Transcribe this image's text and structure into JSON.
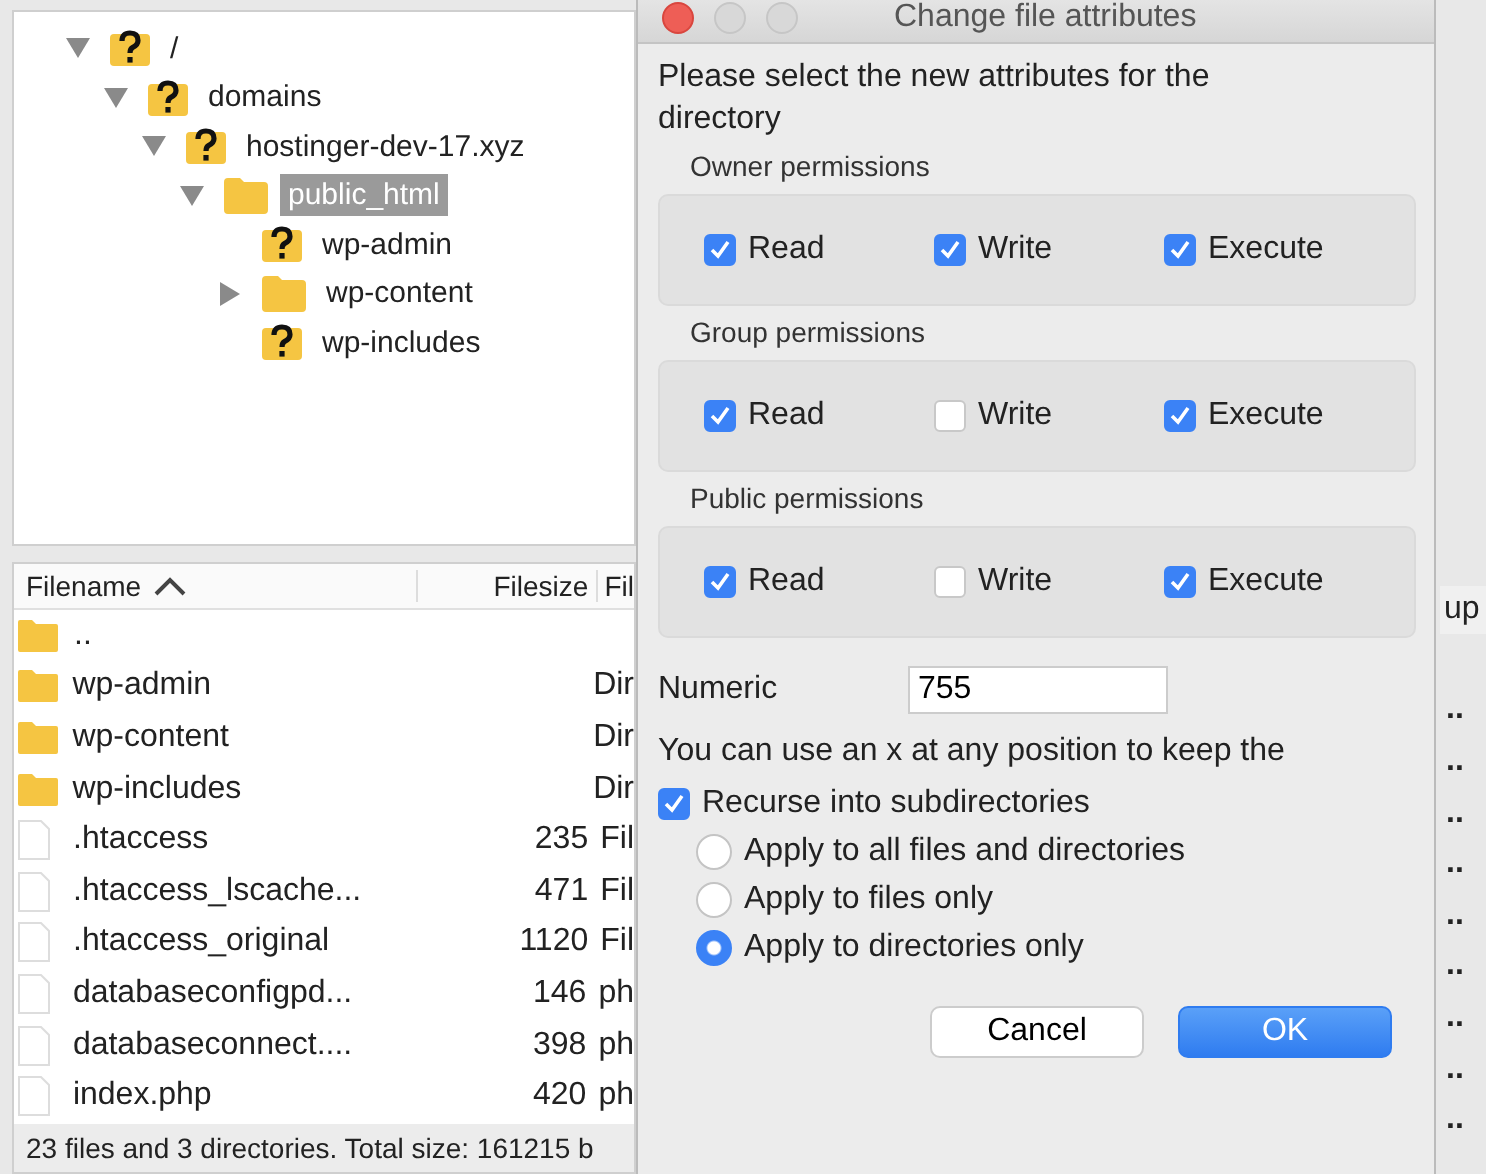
{
  "tree": [
    {
      "label": "/",
      "kind": "unknown",
      "expanded": true,
      "selected": false,
      "children": [
        {
          "label": "domains",
          "kind": "unknown",
          "expanded": true,
          "selected": false,
          "children": [
            {
              "label": "hostinger-dev-17.xyz",
              "kind": "unknown",
              "expanded": true,
              "selected": false,
              "children": [
                {
                  "label": "public_html",
                  "kind": "folder",
                  "expanded": true,
                  "selected": true,
                  "children": [
                    {
                      "label": "wp-admin",
                      "kind": "unknown",
                      "selected": false
                    },
                    {
                      "label": "wp-content",
                      "kind": "folder",
                      "expanded": false,
                      "selected": false
                    },
                    {
                      "label": "wp-includes",
                      "kind": "unknown",
                      "selected": false
                    }
                  ]
                }
              ]
            }
          ]
        }
      ]
    }
  ],
  "file_list": {
    "columns": [
      "Filename",
      "Filesize",
      "Fil"
    ],
    "right_header": "up",
    "rows": [
      {
        "kind": "folder",
        "name": "..",
        "size": "",
        "type": "",
        "column_4": ""
      },
      {
        "kind": "folder",
        "name": "wp-admin",
        "size": "",
        "type": "Dir",
        "column_4": ".."
      },
      {
        "kind": "folder",
        "name": "wp-content",
        "size": "",
        "type": "Dir",
        "column_4": ".."
      },
      {
        "kind": "folder",
        "name": "wp-includes",
        "size": "",
        "type": "Dir",
        "column_4": ".."
      },
      {
        "kind": "file",
        "name": ".htaccess",
        "size": "235",
        "type": "Fil",
        "column_4": ".."
      },
      {
        "kind": "file",
        "name": ".htaccess_lscache...",
        "size": "471",
        "type": "Fil",
        "column_4": ".."
      },
      {
        "kind": "file",
        "name": ".htaccess_original",
        "size": "1120",
        "type": "Fil",
        "column_4": ".."
      },
      {
        "kind": "file",
        "name": "databaseconfigpd...",
        "size": "146",
        "type": "ph",
        "column_4": ".."
      },
      {
        "kind": "file",
        "name": "databaseconnect....",
        "size": "398",
        "type": "ph",
        "column_4": ".."
      },
      {
        "kind": "file",
        "name": "index.php",
        "size": "420",
        "type": "ph",
        "column_4": ".."
      }
    ],
    "status": "23 files and 3 directories. Total size: 161215 b"
  },
  "dialog": {
    "title": "Change file attributes",
    "prompt": "Please select the new attributes for the directory",
    "groups": [
      {
        "title": "Owner permissions",
        "items": [
          {
            "label": "Read",
            "checked": true
          },
          {
            "label": "Write",
            "checked": true
          },
          {
            "label": "Execute",
            "checked": true
          }
        ]
      },
      {
        "title": "Group permissions",
        "items": [
          {
            "label": "Read",
            "checked": true
          },
          {
            "label": "Write",
            "checked": false
          },
          {
            "label": "Execute",
            "checked": true
          }
        ]
      },
      {
        "title": "Public permissions",
        "items": [
          {
            "label": "Read",
            "checked": true
          },
          {
            "label": "Write",
            "checked": false
          },
          {
            "label": "Execute",
            "checked": true
          }
        ]
      }
    ],
    "numeric_label": "Numeric",
    "numeric_value": "755",
    "hint": "You can use an x at any position to keep the",
    "recurse": {
      "label": "Recurse into subdirectories",
      "checked": true
    },
    "apply_options": [
      {
        "label": "Apply to all files and directories",
        "selected": false
      },
      {
        "label": "Apply to files only",
        "selected": false
      },
      {
        "label": "Apply to directories only",
        "selected": true
      }
    ],
    "buttons": {
      "cancel": "Cancel",
      "ok": "OK"
    }
  }
}
